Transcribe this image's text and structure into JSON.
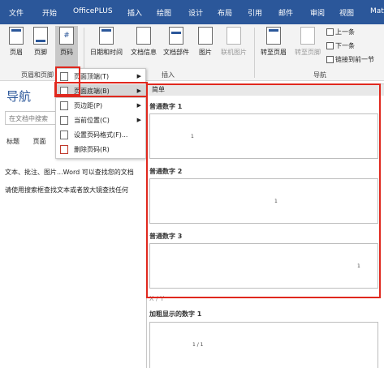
{
  "menubar": {
    "tabs": [
      "文件",
      "开始",
      "OfficePLUS",
      "插入",
      "绘图",
      "设计",
      "布局",
      "引用",
      "邮件",
      "审阅",
      "视图",
      "Mat"
    ]
  },
  "ribbon": {
    "header_footer": {
      "header": "页眉",
      "footer": "页脚",
      "page_number": "页码",
      "group_label": "页眉和页脚"
    },
    "insert": {
      "date_time": "日期和时间",
      "doc_info": "文档信息",
      "doc_parts": "文档部件",
      "picture": "图片",
      "online_picture": "联机图片",
      "group_label": "插入"
    },
    "navigation": {
      "goto_header": "转至页眉",
      "goto_footer": "转至页脚",
      "previous": "上一条",
      "next": "下一条",
      "link_previous": "链接到前一节",
      "group_label": "导航"
    }
  },
  "nav_pane": {
    "title": "导航",
    "search_placeholder": "在文档中搜索",
    "tabs": [
      "标题",
      "页面"
    ],
    "text_line1": "文本、批注、图片...Word 可以查找您的文档",
    "text_line2": "请使用搜索框查找文本或者放大镜查找任何"
  },
  "context_menu": {
    "items": [
      {
        "label": "页面顶端(T)",
        "submenu": true
      },
      {
        "label": "页面底端(B)",
        "submenu": true
      },
      {
        "label": "页边距(P)",
        "submenu": true
      },
      {
        "label": "当前位置(C)",
        "submenu": true
      },
      {
        "label": "设置页码格式(F)...",
        "submenu": false
      },
      {
        "label": "删除页码(R)",
        "submenu": false
      }
    ],
    "active_index": 1
  },
  "gallery": {
    "section_simple": "简单",
    "items": [
      {
        "label": "普通数字 1",
        "digit": "1"
      },
      {
        "label": "普通数字 2",
        "digit": "1"
      },
      {
        "label": "普通数字 3",
        "digit": "1"
      }
    ],
    "section_xy": "X / Y",
    "bold_item": {
      "label": "加粗显示的数字 1",
      "digit": "1 / 1"
    }
  },
  "colors": {
    "accent": "#2b579a",
    "highlight": "#e0281e"
  }
}
